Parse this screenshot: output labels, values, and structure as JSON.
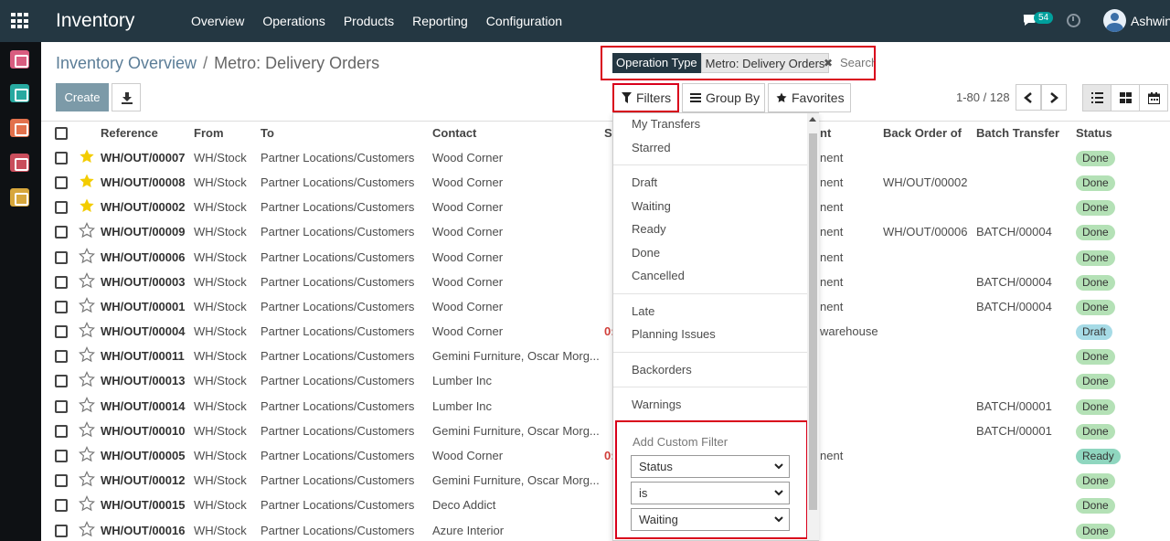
{
  "navbar": {
    "brand": "Inventory",
    "menu": [
      "Overview",
      "Operations",
      "Products",
      "Reporting",
      "Configuration"
    ],
    "chat_count": "54",
    "user": "Ashwin"
  },
  "dock": {
    "apps": [
      {
        "name": "discuss",
        "color": "#d95d80"
      },
      {
        "name": "contacts",
        "color": "#27a9a0"
      },
      {
        "name": "reporting",
        "color": "#e2714c"
      },
      {
        "name": "inventory",
        "color": "#c94e5c"
      },
      {
        "name": "settings",
        "color": "#d7a73c"
      }
    ]
  },
  "breadcrumb": {
    "parent": "Inventory Overview",
    "separator": "/",
    "current": "Metro: Delivery Orders"
  },
  "toolbar": {
    "create_label": "Create"
  },
  "search": {
    "facet_label": "Operation Type",
    "facet_value": "Metro: Delivery Orders",
    "placeholder": "Search..."
  },
  "filter_buttons": {
    "filters": "Filters",
    "group_by": "Group By",
    "favorites": "Favorites"
  },
  "pager": {
    "range": "1-80 / 128"
  },
  "table": {
    "headers": {
      "reference": "Reference",
      "from": "From",
      "to": "To",
      "contact": "Contact",
      "scheduled_partial": "S",
      "source_partial": "nt",
      "back_order": "Back Order of",
      "batch": "Batch Transfer",
      "status": "Status"
    },
    "rows": [
      {
        "ref": "WH/OUT/00007",
        "from": "WH/Stock",
        "to": "Partner Locations/Customers",
        "contact": "Wood Corner",
        "sched": "",
        "source": "nent",
        "back": "",
        "batch": "",
        "status": "Done",
        "starred": true
      },
      {
        "ref": "WH/OUT/00008",
        "from": "WH/Stock",
        "to": "Partner Locations/Customers",
        "contact": "Wood Corner",
        "sched": "",
        "source": "nent",
        "back": "WH/OUT/00002",
        "batch": "",
        "status": "Done",
        "starred": true
      },
      {
        "ref": "WH/OUT/00002",
        "from": "WH/Stock",
        "to": "Partner Locations/Customers",
        "contact": "Wood Corner",
        "sched": "",
        "source": "nent",
        "back": "",
        "batch": "",
        "status": "Done",
        "starred": true
      },
      {
        "ref": "WH/OUT/00009",
        "from": "WH/Stock",
        "to": "Partner Locations/Customers",
        "contact": "Wood Corner",
        "sched": "",
        "source": "nent",
        "back": "WH/OUT/00006",
        "batch": "BATCH/00004",
        "status": "Done",
        "starred": false
      },
      {
        "ref": "WH/OUT/00006",
        "from": "WH/Stock",
        "to": "Partner Locations/Customers",
        "contact": "Wood Corner",
        "sched": "",
        "source": "nent",
        "back": "",
        "batch": "",
        "status": "Done",
        "starred": false
      },
      {
        "ref": "WH/OUT/00003",
        "from": "WH/Stock",
        "to": "Partner Locations/Customers",
        "contact": "Wood Corner",
        "sched": "",
        "source": "nent",
        "back": "",
        "batch": "BATCH/00004",
        "status": "Done",
        "starred": false
      },
      {
        "ref": "WH/OUT/00001",
        "from": "WH/Stock",
        "to": "Partner Locations/Customers",
        "contact": "Wood Corner",
        "sched": "",
        "source": "nent",
        "back": "",
        "batch": "BATCH/00004",
        "status": "Done",
        "starred": false
      },
      {
        "ref": "WH/OUT/00004",
        "from": "WH/Stock",
        "to": "Partner Locations/Customers",
        "contact": "Wood Corner",
        "sched": "0:",
        "source": "warehouse",
        "back": "",
        "batch": "",
        "status": "Draft",
        "starred": false
      },
      {
        "ref": "WH/OUT/00011",
        "from": "WH/Stock",
        "to": "Partner Locations/Customers",
        "contact": "Gemini Furniture, Oscar Morg...",
        "sched": "",
        "source": "",
        "back": "",
        "batch": "",
        "status": "Done",
        "starred": false
      },
      {
        "ref": "WH/OUT/00013",
        "from": "WH/Stock",
        "to": "Partner Locations/Customers",
        "contact": "Lumber Inc",
        "sched": "",
        "source": "",
        "back": "",
        "batch": "",
        "status": "Done",
        "starred": false
      },
      {
        "ref": "WH/OUT/00014",
        "from": "WH/Stock",
        "to": "Partner Locations/Customers",
        "contact": "Lumber Inc",
        "sched": "",
        "source": "",
        "back": "",
        "batch": "BATCH/00001",
        "status": "Done",
        "starred": false
      },
      {
        "ref": "WH/OUT/00010",
        "from": "WH/Stock",
        "to": "Partner Locations/Customers",
        "contact": "Gemini Furniture, Oscar Morg...",
        "sched": "",
        "source": "",
        "back": "",
        "batch": "BATCH/00001",
        "status": "Done",
        "starred": false
      },
      {
        "ref": "WH/OUT/00005",
        "from": "WH/Stock",
        "to": "Partner Locations/Customers",
        "contact": "Wood Corner",
        "sched": "0:",
        "source": "nent",
        "back": "",
        "batch": "",
        "status": "Ready",
        "starred": false
      },
      {
        "ref": "WH/OUT/00012",
        "from": "WH/Stock",
        "to": "Partner Locations/Customers",
        "contact": "Gemini Furniture, Oscar Morg...",
        "sched": "",
        "source": "",
        "back": "",
        "batch": "",
        "status": "Done",
        "starred": false
      },
      {
        "ref": "WH/OUT/00015",
        "from": "WH/Stock",
        "to": "Partner Locations/Customers",
        "contact": "Deco Addict",
        "sched": "",
        "source": "",
        "back": "",
        "batch": "",
        "status": "Done",
        "starred": false
      },
      {
        "ref": "WH/OUT/00016",
        "from": "WH/Stock",
        "to": "Partner Locations/Customers",
        "contact": "Azure Interior",
        "sched": "",
        "source": "",
        "back": "",
        "batch": "",
        "status": "Done",
        "starred": false
      }
    ]
  },
  "status_colors": {
    "Done": "#b4e1b6",
    "Draft": "#a6dbe6",
    "Ready": "#8fd6bf"
  },
  "filters_dropdown": {
    "groups": [
      [
        "My Transfers",
        "Starred"
      ],
      [
        "Draft",
        "Waiting",
        "Ready",
        "Done",
        "Cancelled"
      ],
      [
        "Late",
        "Planning Issues"
      ],
      [
        "Backorders"
      ],
      [
        "Warnings"
      ]
    ],
    "custom_filter": {
      "title": "Add Custom Filter",
      "field": "Status",
      "operator": "is",
      "value": "Waiting"
    }
  }
}
